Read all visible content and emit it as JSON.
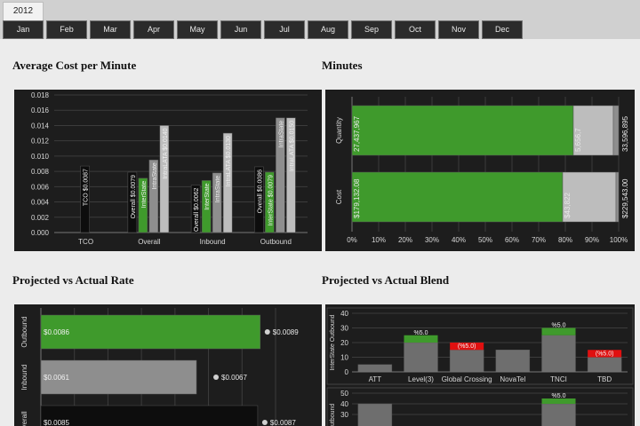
{
  "year_tab": "2012",
  "months": [
    "Jan",
    "Feb",
    "Mar",
    "Apr",
    "May",
    "Jun",
    "Jul",
    "Aug",
    "Sep",
    "Oct",
    "Nov",
    "Dec"
  ],
  "titles": {
    "avg_cost": "Average Cost per Minute",
    "minutes": "Minutes",
    "proj_rate": "Projected vs Actual Rate",
    "proj_blend": "Projected vs Actual Blend"
  },
  "colors": {
    "green": "#3f9a2c",
    "grey": "#8e8e8e",
    "light": "#bdbdbd",
    "red": "#e01010",
    "panel": "#1d1d1d"
  },
  "chart_data": [
    {
      "id": "avg_cost",
      "type": "bar",
      "categories": [
        "TCO",
        "Overall",
        "Inbound",
        "Outbound"
      ],
      "ylim": [
        0,
        0.018
      ],
      "yticks": [
        "0.000",
        "0.002",
        "0.004",
        "0.006",
        "0.008",
        "0.010",
        "0.012",
        "0.014",
        "0.016",
        "0.018"
      ],
      "bars": [
        {
          "cat": 0,
          "value": 0.0087,
          "label": "TCO $0.0087",
          "color": "dark"
        },
        {
          "cat": 1,
          "value": 0.0079,
          "label": "Overall $0.0079",
          "color": "dark"
        },
        {
          "cat": 1,
          "value": 0.0071,
          "label": "InterState",
          "color": "green"
        },
        {
          "cat": 1,
          "value": 0.0095,
          "label": "IntraState",
          "color": "grey"
        },
        {
          "cat": 1,
          "value": 0.014,
          "label": "IntraLATA $0.0140",
          "color": "light"
        },
        {
          "cat": 2,
          "value": 0.0062,
          "label": "Overall $0.0062",
          "color": "dark"
        },
        {
          "cat": 2,
          "value": 0.0068,
          "label": "InterState",
          "color": "green"
        },
        {
          "cat": 2,
          "value": 0.0078,
          "label": "IntraState",
          "color": "grey"
        },
        {
          "cat": 2,
          "value": 0.013,
          "label": "IntraLATA $0.0130",
          "color": "light"
        },
        {
          "cat": 3,
          "value": 0.0086,
          "label": "Overall $0.0086",
          "color": "dark"
        },
        {
          "cat": 3,
          "value": 0.0079,
          "label": "InterState $0.0079",
          "color": "green"
        },
        {
          "cat": 3,
          "value": 0.015,
          "label": "IntraState",
          "color": "grey"
        },
        {
          "cat": 3,
          "value": 0.015,
          "label": "IntraLATA $0.0150",
          "color": "light"
        }
      ]
    },
    {
      "id": "minutes",
      "type": "bar",
      "orientation": "horizontal-stacked-percent",
      "categories": [
        "Quantity",
        "Cost"
      ],
      "xticks": [
        "0%",
        "10%",
        "20%",
        "30%",
        "40%",
        "50%",
        "60%",
        "70%",
        "80%",
        "90%",
        "100%"
      ],
      "rows": [
        {
          "name": "Quantity",
          "segments": [
            {
              "pct": 83,
              "label": "27,437,967",
              "color": "green"
            },
            {
              "pct": 15,
              "label": "5,656,7",
              "color": "light"
            },
            {
              "pct": 2,
              "label": "",
              "color": "grey"
            }
          ],
          "total_label": "33,596,895"
        },
        {
          "name": "Cost",
          "segments": [
            {
              "pct": 79,
              "label": "$179,132.08",
              "color": "green"
            },
            {
              "pct": 20,
              "label": "$43,822",
              "color": "light"
            },
            {
              "pct": 1,
              "label": "",
              "color": "grey"
            }
          ],
          "total_label": "$229,543.00"
        }
      ]
    },
    {
      "id": "proj_rate",
      "type": "bar",
      "orientation": "horizontal",
      "xmax": 0.0092,
      "rows": [
        {
          "name": "Outbound",
          "actual": 0.0086,
          "actual_label": "$0.0086",
          "projected_label": "$0.0089",
          "color": "green"
        },
        {
          "name": "Inbound",
          "actual": 0.0061,
          "actual_label": "$0.0061",
          "projected_label": "$0.0067",
          "color": "grey"
        },
        {
          "name": "Overall",
          "actual": 0.0085,
          "actual_label": "$0.0085",
          "projected_label": "$0.0087",
          "color": "dark"
        }
      ]
    },
    {
      "id": "blend_interstate",
      "type": "bar",
      "ylabel": "InterState Outbound",
      "ylim": [
        0,
        40
      ],
      "yticks": [
        "0",
        "10",
        "20",
        "30",
        "40"
      ],
      "categories": [
        "ATT",
        "Level(3)",
        "Global Crossing",
        "NovaTel",
        "TNCI",
        "TBD"
      ],
      "values": [
        5,
        20,
        15,
        15,
        25,
        10
      ],
      "deltas": [
        0,
        5,
        -5,
        0,
        5,
        -5
      ],
      "delta_labels": [
        "",
        "%5.0",
        "(%5.0)",
        "",
        "%5.0",
        "(%5.0)"
      ]
    },
    {
      "id": "blend_second",
      "type": "bar",
      "ylabel": "e Outbound",
      "ylim": [
        0,
        50
      ],
      "yticks": [
        "30",
        "40",
        "50"
      ],
      "categories": [
        "ATT",
        "Level(3)",
        "Global Crossing",
        "NovaTel",
        "TNCI",
        "TBD"
      ],
      "values": [
        40,
        0,
        0,
        0,
        40,
        0
      ],
      "deltas": [
        0,
        0,
        0,
        0,
        5,
        0
      ],
      "delta_labels": [
        "",
        "",
        "",
        "",
        "%5.0",
        ""
      ]
    }
  ]
}
